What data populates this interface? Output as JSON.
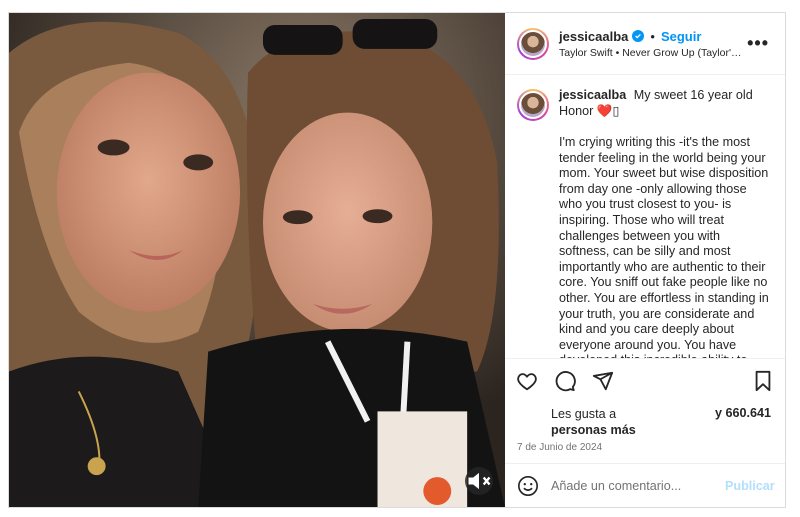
{
  "post": {
    "username": "jessicaalba",
    "follow_label": "Seguir",
    "separator": "•",
    "music": "Taylor Swift • Never Grow Up (Taylor's ...",
    "more_label": "•••",
    "caption_title": "My sweet 16 year old Honor",
    "caption_emoji": "❤️",
    "caption_emoji2": "▯",
    "caption_body": "I'm crying writing this -it's the most tender feeling in the world being your mom. Your sweet but wise disposition from day one -only allowing those who you trust closest to you- is inspiring. Those who will treat challenges between you with softness, can be silly and most importantly who are authentic to their core. You sniff out fake people like no other. You are effortless in standing in your truth, you are considerate and kind and you care deeply about everyone around you. You have developed this incredible ability to help others without getting sucked into drama",
    "likes_prefix": "Les gusta a",
    "likes_others": "personas más",
    "likes_count": "y 660.641",
    "date": "7 de Junio de 2024",
    "comment_placeholder": "Añade un comentario...",
    "publish_label": "Publicar"
  },
  "icons": [
    "heart-icon",
    "comment-icon",
    "share-icon",
    "bookmark-icon",
    "emoji-icon",
    "mute-icon",
    "verified-icon",
    "more-options-icon"
  ],
  "colors": {
    "accent": "#0095f6",
    "heart": "#ed4956",
    "publish_disabled": "#b2dffc",
    "muted_text": "#737373"
  }
}
